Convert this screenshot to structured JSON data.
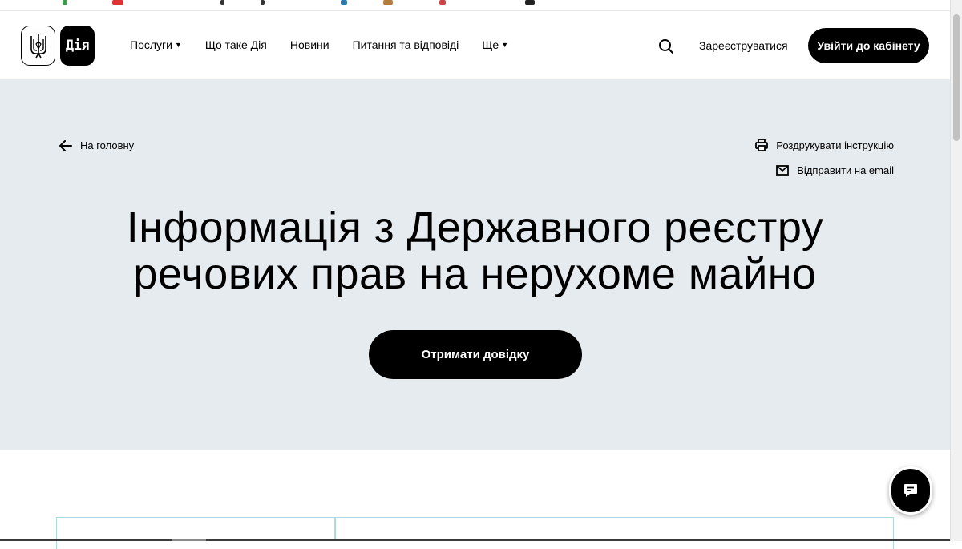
{
  "header": {
    "logo_text": "Дія",
    "nav": [
      {
        "label": "Послуги",
        "has_dropdown": true
      },
      {
        "label": "Що таке Дія",
        "has_dropdown": false
      },
      {
        "label": "Новини",
        "has_dropdown": false
      },
      {
        "label": "Питання та відповіді",
        "has_dropdown": false
      },
      {
        "label": "Ще",
        "has_dropdown": true
      }
    ],
    "register_label": "Зареєструватися",
    "login_label": "Увійти до кабінету"
  },
  "hero": {
    "back_label": "На головну",
    "print_label": "Роздрукувати інструкцію",
    "email_label": "Відправити на email",
    "title_line1": "Інформація з Державного реєстру",
    "title_line2": "речових прав на нерухоме майно",
    "cta_label": "Отримати довідку"
  },
  "colors": {
    "hero_bg": "#e6ebf0",
    "accent": "#000000",
    "card_border": "#aadbe0"
  },
  "icons": {
    "logo": "trident-icon",
    "search": "search-icon",
    "back": "arrow-left-icon",
    "print": "printer-icon",
    "email": "mail-icon",
    "chat": "chat-icon",
    "dropdown": "caret-down-icon"
  }
}
